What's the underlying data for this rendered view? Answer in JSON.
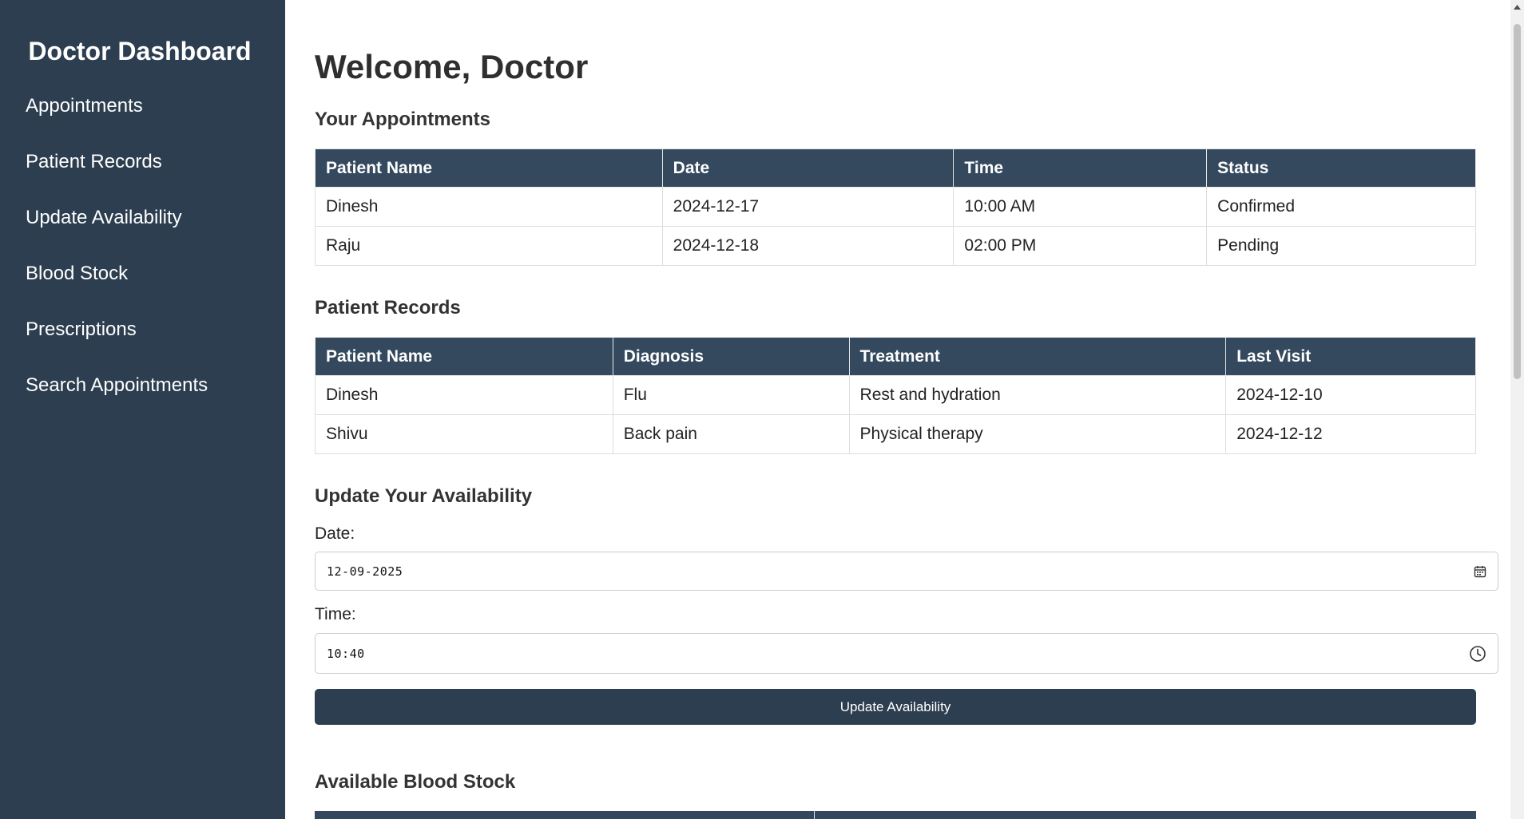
{
  "sidebar": {
    "title": "Doctor Dashboard",
    "items": [
      {
        "label": "Appointments"
      },
      {
        "label": "Patient Records"
      },
      {
        "label": "Update Availability"
      },
      {
        "label": "Blood Stock"
      },
      {
        "label": "Prescriptions"
      },
      {
        "label": "Search Appointments"
      }
    ]
  },
  "main": {
    "title": "Welcome, Doctor",
    "appointments": {
      "heading": "Your Appointments",
      "columns": [
        "Patient Name",
        "Date",
        "Time",
        "Status"
      ],
      "rows": [
        [
          "Dinesh",
          "2024-12-17",
          "10:00 AM",
          "Confirmed"
        ],
        [
          "Raju",
          "2024-12-18",
          "02:00 PM",
          "Pending"
        ]
      ]
    },
    "records": {
      "heading": "Patient Records",
      "columns": [
        "Patient Name",
        "Diagnosis",
        "Treatment",
        "Last Visit"
      ],
      "rows": [
        [
          "Dinesh",
          "Flu",
          "Rest and hydration",
          "2024-12-10"
        ],
        [
          "Shivu",
          "Back pain",
          "Physical therapy",
          "2024-12-12"
        ]
      ]
    },
    "availability": {
      "heading": "Update Your Availability",
      "date_label": "Date:",
      "date_value": "12-09-2025",
      "date_icon": "calendar-icon",
      "time_label": "Time:",
      "time_value": "10:40",
      "time_icon": "clock-icon",
      "button_label": "Update Availability"
    },
    "blood_stock": {
      "heading": "Available Blood Stock"
    }
  },
  "colors": {
    "sidebar_bg": "#2c3e50",
    "table_header_bg": "#34495e",
    "button_bg": "#2c3e50"
  }
}
